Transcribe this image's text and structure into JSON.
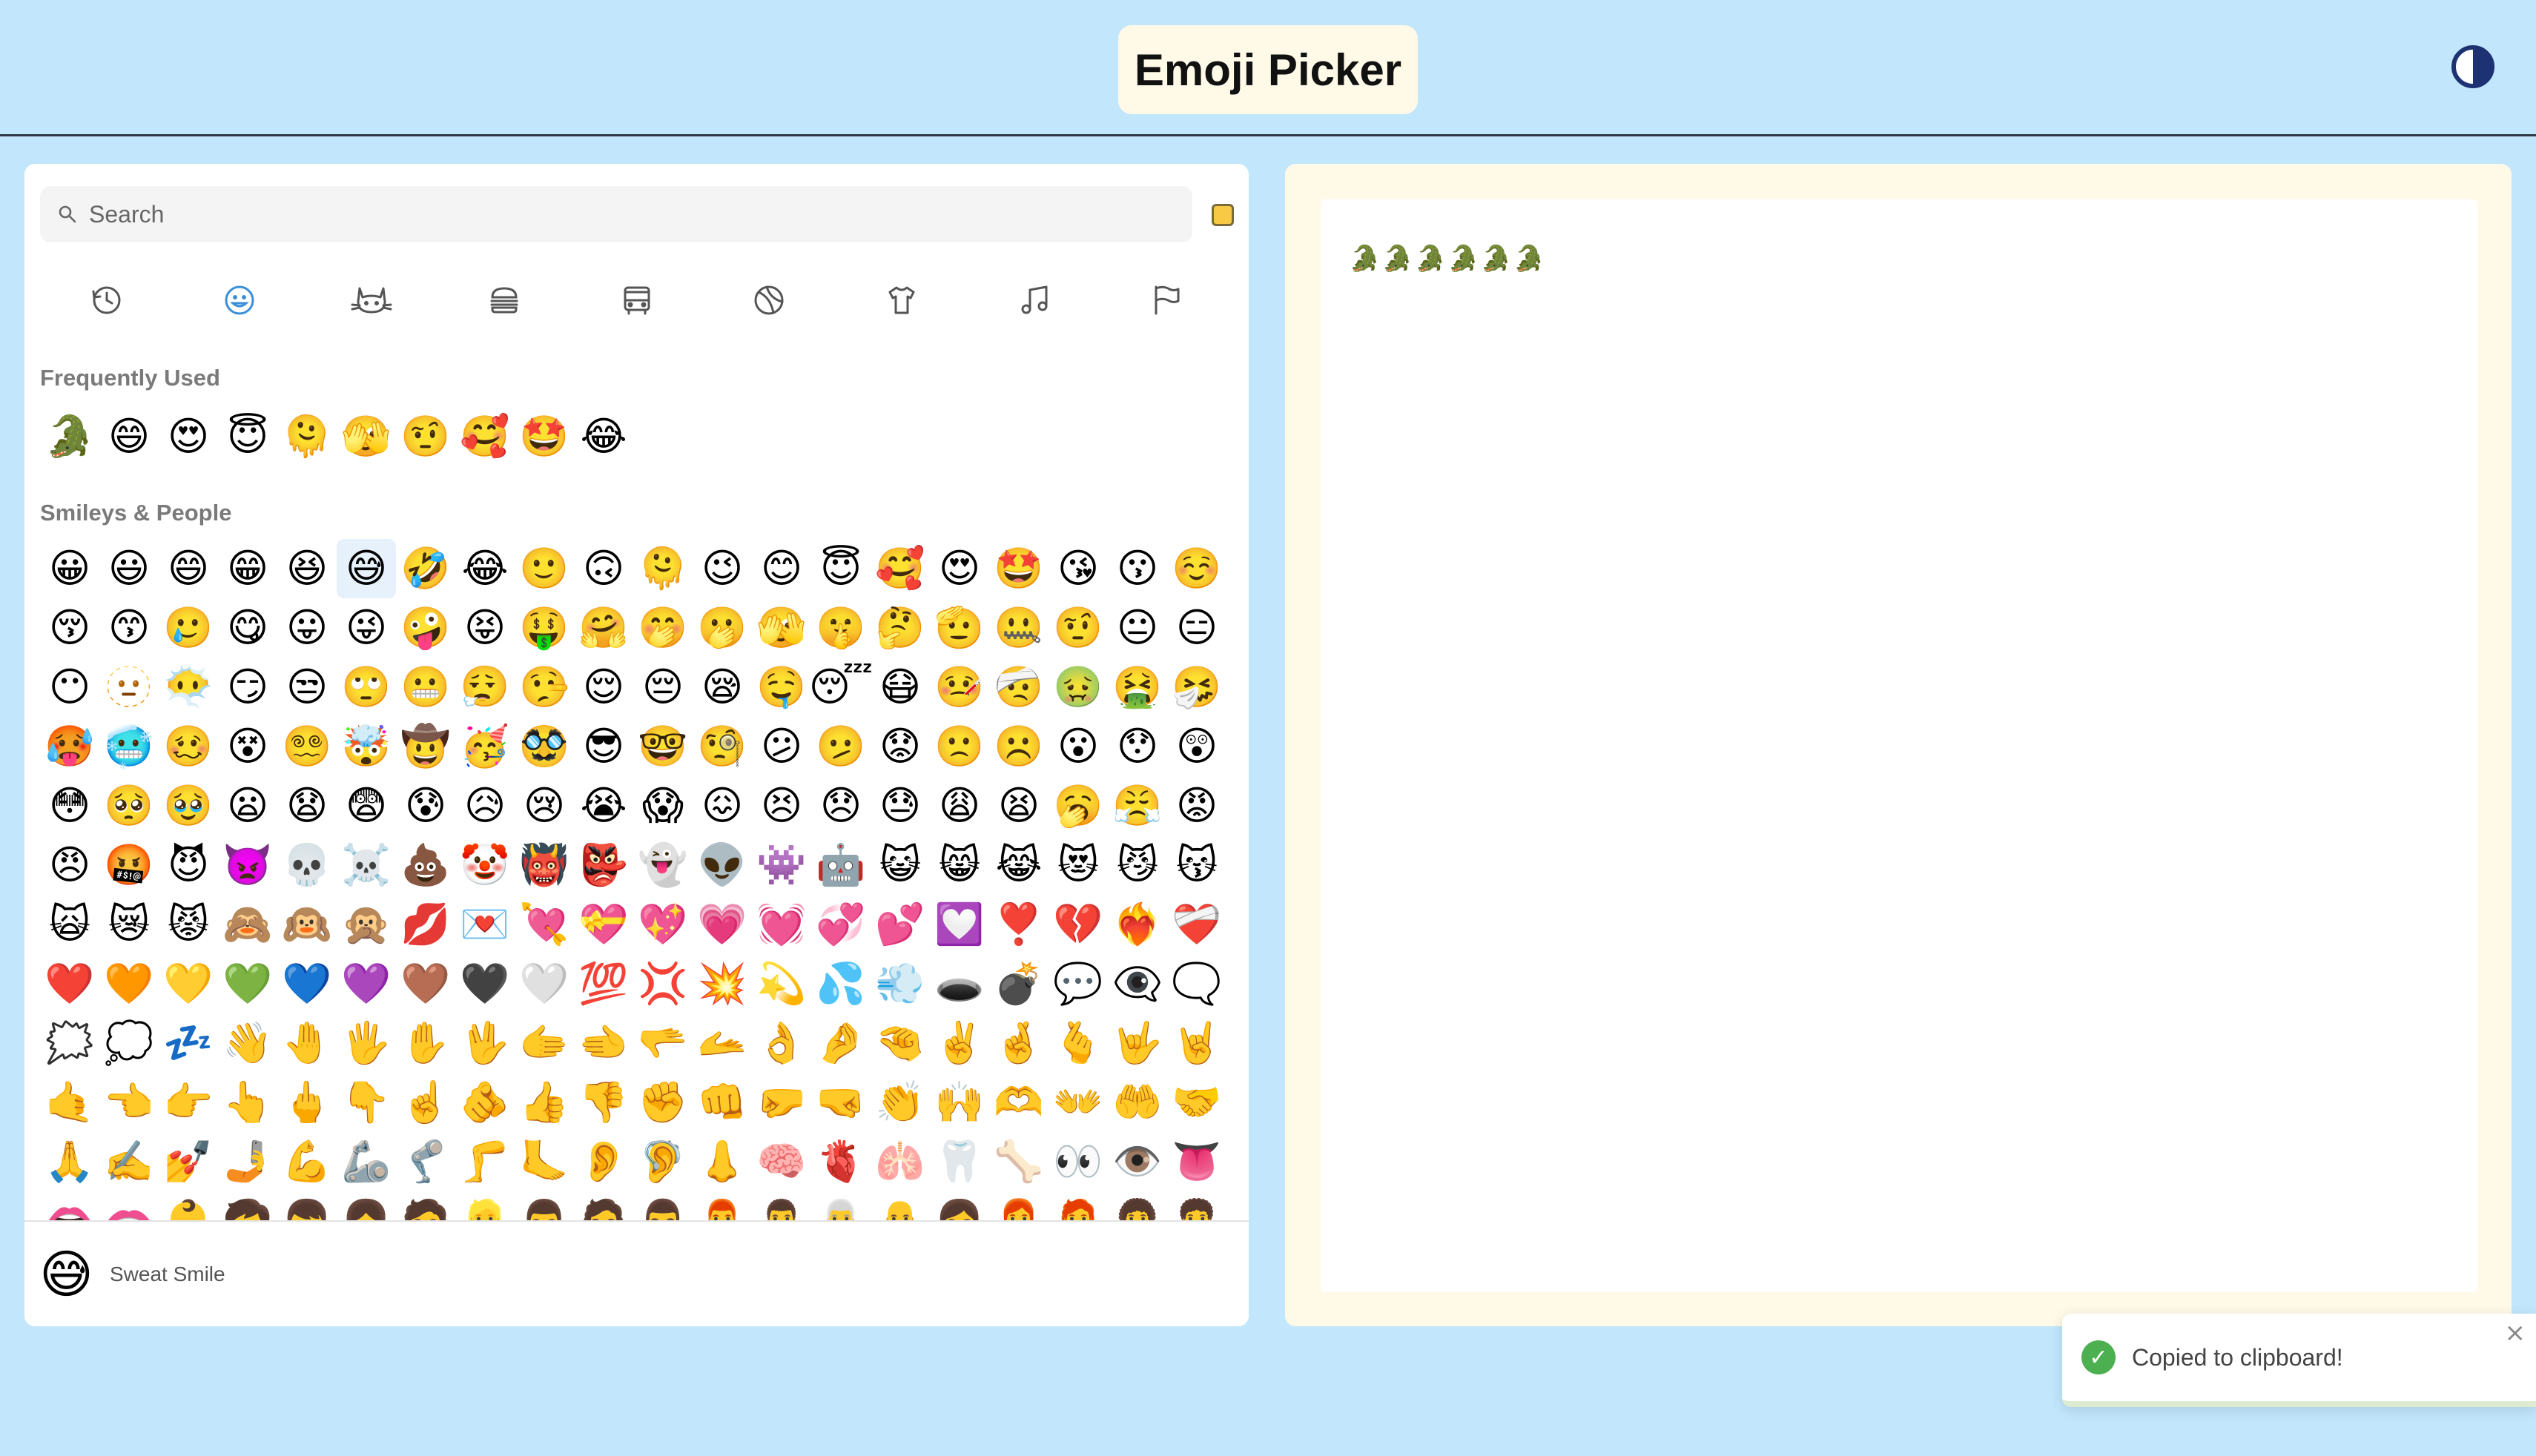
{
  "app": {
    "title": "Emoji Picker",
    "theme_toggle_icon": "contrast-icon"
  },
  "search": {
    "placeholder": "Search",
    "value": ""
  },
  "skin_tone": {
    "color": "#f7c945"
  },
  "categories": [
    {
      "name": "recent",
      "icon": "clock-icon",
      "active": false
    },
    {
      "name": "smileys",
      "icon": "smiley-icon",
      "active": true
    },
    {
      "name": "animals",
      "icon": "cat-icon",
      "active": false
    },
    {
      "name": "food",
      "icon": "burger-icon",
      "active": false
    },
    {
      "name": "travel",
      "icon": "bus-icon",
      "active": false
    },
    {
      "name": "activities",
      "icon": "ball-icon",
      "active": false
    },
    {
      "name": "objects",
      "icon": "shirt-icon",
      "active": false
    },
    {
      "name": "symbols",
      "icon": "music-icon",
      "active": false
    },
    {
      "name": "flags",
      "icon": "flag-icon",
      "active": false
    }
  ],
  "sections": {
    "frequent": {
      "title": "Frequently Used",
      "emojis": [
        "🐊",
        "😄",
        "😍",
        "😇",
        "🫠",
        "🫣",
        "🤨",
        "🥰",
        "🤩",
        "😂"
      ]
    },
    "smileys": {
      "title": "Smileys & People",
      "selected_index": 5,
      "emojis": [
        "😀",
        "😃",
        "😄",
        "😁",
        "😆",
        "😅",
        "🤣",
        "😂",
        "🙂",
        "🙃",
        "🫠",
        "😉",
        "😊",
        "😇",
        "🥰",
        "😍",
        "🤩",
        "😘",
        "😗",
        "☺️",
        "😚",
        "😙",
        "🥲",
        "😋",
        "😛",
        "😜",
        "🤪",
        "😝",
        "🤑",
        "🤗",
        "🤭",
        "🫢",
        "🫣",
        "🤫",
        "🤔",
        "🫡",
        "🤐",
        "🤨",
        "😐",
        "😑",
        "😶",
        "🫥",
        "😶‍🌫️",
        "😏",
        "😒",
        "🙄",
        "😬",
        "😮‍💨",
        "🤥",
        "😌",
        "😔",
        "😪",
        "🤤",
        "😴",
        "😷",
        "🤒",
        "🤕",
        "🤢",
        "🤮",
        "🤧",
        "🥵",
        "🥶",
        "🥴",
        "😵",
        "😵‍💫",
        "🤯",
        "🤠",
        "🥳",
        "🥸",
        "😎",
        "🤓",
        "🧐",
        "😕",
        "🫤",
        "😟",
        "🙁",
        "☹️",
        "😮",
        "😯",
        "😲",
        "😳",
        "🥺",
        "🥹",
        "😦",
        "😧",
        "😨",
        "😰",
        "😥",
        "😢",
        "😭",
        "😱",
        "😖",
        "😣",
        "😞",
        "😓",
        "😩",
        "😫",
        "🥱",
        "😤",
        "😡",
        "😠",
        "🤬",
        "😈",
        "👿",
        "💀",
        "☠️",
        "💩",
        "🤡",
        "👹",
        "👺",
        "👻",
        "👽",
        "👾",
        "🤖",
        "😺",
        "😸",
        "😹",
        "😻",
        "😼",
        "😽",
        "🙀",
        "😿",
        "😾",
        "🙈",
        "🙉",
        "🙊",
        "💋",
        "💌",
        "💘",
        "💝",
        "💖",
        "💗",
        "💓",
        "💞",
        "💕",
        "💟",
        "❣️",
        "💔",
        "❤️‍🔥",
        "❤️‍🩹",
        "❤️",
        "🧡",
        "💛",
        "💚",
        "💙",
        "💜",
        "🤎",
        "🖤",
        "🤍",
        "💯",
        "💢",
        "💥",
        "💫",
        "💦",
        "💨",
        "🕳️",
        "💣",
        "💬",
        "👁️‍🗨️",
        "🗨️",
        "🗯️",
        "💭",
        "💤",
        "👋",
        "🤚",
        "🖐️",
        "✋",
        "🖖",
        "🫱",
        "🫲",
        "🫳",
        "🫴",
        "👌",
        "🤌",
        "🤏",
        "✌️",
        "🤞",
        "🫰",
        "🤟",
        "🤘",
        "🤙",
        "👈",
        "👉",
        "👆",
        "🖕",
        "👇",
        "☝️",
        "🫵",
        "👍",
        "👎",
        "✊",
        "👊",
        "🤛",
        "🤜",
        "👏",
        "🙌",
        "🫶",
        "👐",
        "🤲",
        "🤝",
        "🙏",
        "✍️",
        "💅",
        "🤳",
        "💪",
        "🦾",
        "🦿",
        "🦵",
        "🦶",
        "👂",
        "🦻",
        "👃",
        "🧠",
        "🫀",
        "🫁",
        "🦷",
        "🦴",
        "👀",
        "👁️",
        "👅",
        "👄",
        "🫦",
        "👶",
        "🧒",
        "👦",
        "👧",
        "🧑",
        "👱",
        "👨",
        "🧔",
        "🧔‍♂️",
        "👨‍🦰",
        "👨‍🦱",
        "👨‍🦳",
        "👨‍🦲",
        "👩",
        "👩‍🦰",
        "🧑‍🦰",
        "👩‍🦱",
        "🧑‍🦱"
      ]
    }
  },
  "preview": {
    "emoji": "😅",
    "name": "Sweat Smile"
  },
  "editor": {
    "content": "🐊🐊🐊🐊🐊🐊"
  },
  "toast": {
    "message": "Copied to clipboard!",
    "close": "×",
    "check": "✓"
  }
}
